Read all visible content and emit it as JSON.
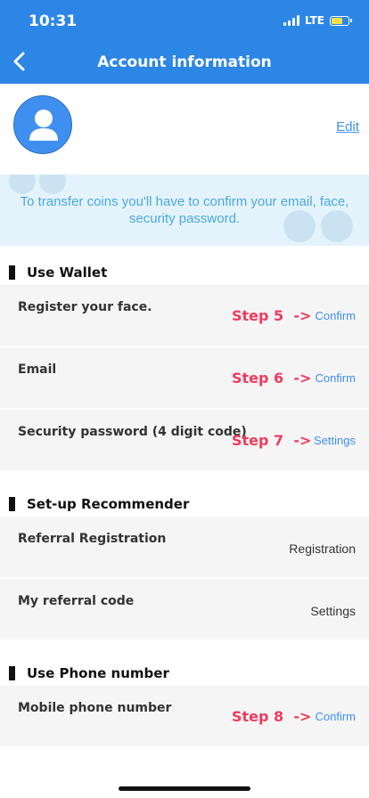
{
  "status_bar": {
    "time": "10:31",
    "network": "LTE"
  },
  "header": {
    "title": "Account information",
    "back_icon": "chevron-left-icon"
  },
  "profile": {
    "avatar_icon": "user-icon",
    "edit_label": "Edit"
  },
  "notice": {
    "text": "To transfer coins you'll have to confirm your email, face, security password."
  },
  "sections": [
    {
      "title": "Use Wallet",
      "rows": [
        {
          "label": "Register your face.",
          "step": "Step 5",
          "arrow": "->",
          "action": "Confirm"
        },
        {
          "label": "Email",
          "step": "Step 6",
          "arrow": "->",
          "action": "Confirm"
        },
        {
          "label": "Security password (4 digit code)",
          "step": "Step 7",
          "arrow": "->",
          "action": "Settings"
        }
      ]
    },
    {
      "title": "Set-up Recommender",
      "rows": [
        {
          "label": "Referral Registration",
          "action": "Registration"
        },
        {
          "label": "My referral code",
          "action": "Settings"
        }
      ]
    },
    {
      "title": "Use Phone number",
      "rows": [
        {
          "label": "Mobile phone number",
          "step": "Step 8",
          "arrow": "->",
          "action": "Confirm"
        }
      ]
    }
  ],
  "colors": {
    "header": "#2c86e6",
    "accent": "#3e8ff0",
    "step": "#ef3a5d",
    "notice_bg": "#e4f3fb"
  }
}
